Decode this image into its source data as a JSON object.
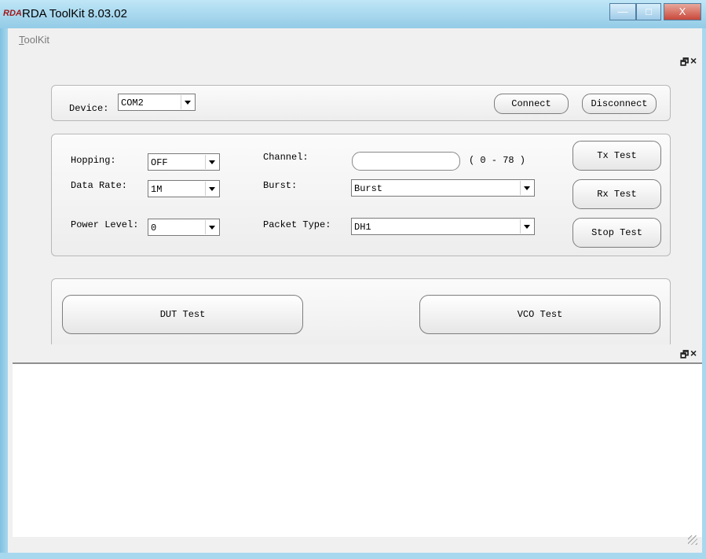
{
  "window": {
    "icon_text": "RDA",
    "title": "RDA ToolKit 8.03.02",
    "minimize_glyph": "—",
    "maximize_glyph": "□",
    "close_glyph": "X"
  },
  "menu": {
    "items": [
      {
        "accelerator": "T",
        "rest": "oolKit"
      }
    ]
  },
  "dock_controls": {
    "restore": "🗗",
    "close": "×"
  },
  "device_group": {
    "device_label": "Device:",
    "device_value": "COM2",
    "connect_label": "Connect",
    "disconnect_label": "Disconnect"
  },
  "test_group": {
    "hopping_label": "Hopping:",
    "hopping_value": "OFF",
    "data_rate_label": "Data Rate:",
    "data_rate_value": "1M",
    "power_level_label": "Power Level:",
    "power_level_value": "0",
    "channel_label": "Channel:",
    "channel_value": "",
    "channel_range": "( 0 - 78 )",
    "burst_label": "Burst:",
    "burst_value": "Burst",
    "packet_type_label": "Packet Type:",
    "packet_type_value": "DH1",
    "tx_test_label": "Tx Test",
    "rx_test_label": "Rx Test",
    "stop_test_label": "Stop Test"
  },
  "mode_group": {
    "dut_test_label": "DUT Test",
    "vco_test_label": "VCO Test"
  },
  "colors": {
    "titlebar": "#93cbe6",
    "close_button": "#c9483a",
    "panel_bg": "#f0f0f0"
  }
}
